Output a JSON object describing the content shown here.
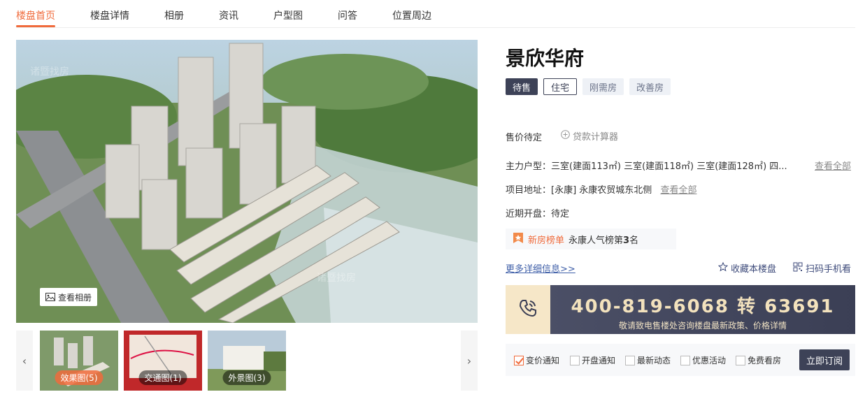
{
  "nav": {
    "items": [
      "楼盘首页",
      "楼盘详情",
      "相册",
      "资讯",
      "户型图",
      "问答",
      "位置周边"
    ],
    "active_index": 0
  },
  "gallery": {
    "album_button": "查看相册",
    "thumbnails": [
      {
        "label": "效果图(5)"
      },
      {
        "label": "交通图(1)"
      },
      {
        "label": "外景图(3)"
      }
    ]
  },
  "project": {
    "name": "景欣华府",
    "tags": {
      "status": "待售",
      "type": "住宅",
      "features": [
        "刚需房",
        "改善房"
      ]
    },
    "price": "售价待定",
    "calculator": "贷款计算器",
    "main_units_label": "主力户型：",
    "main_units_value": "三室(建面113㎡) 三室(建面118㎡) 三室(建面128㎡) 四...",
    "view_all": "查看全部",
    "address_label": "项目地址：",
    "address_value": "[永康] 永康农贸城东北侧",
    "opening_label": "近期开盘：",
    "opening_value": "待定",
    "rank_title": "新房榜单",
    "rank_text_prefix": "永康人气榜第",
    "rank_number": "3",
    "rank_text_suffix": "名",
    "more_info": "更多详细信息>>",
    "favorite": "收藏本楼盘",
    "scan": "扫码手机看"
  },
  "phone": {
    "number": "400-819-6068 转 63691",
    "subtitle": "敬请致电售楼处咨询楼盘最新政策、价格详情"
  },
  "subscribe": {
    "options": [
      {
        "label": "变价通知",
        "checked": true
      },
      {
        "label": "开盘通知",
        "checked": false
      },
      {
        "label": "最新动态",
        "checked": false
      },
      {
        "label": "优惠活动",
        "checked": false
      },
      {
        "label": "免费看房",
        "checked": false
      }
    ],
    "button": "立即订阅"
  },
  "colors": {
    "accent": "#f06b3c",
    "dark": "#3d4257",
    "link": "#3f5fa8",
    "gold": "#f3e2bd"
  }
}
